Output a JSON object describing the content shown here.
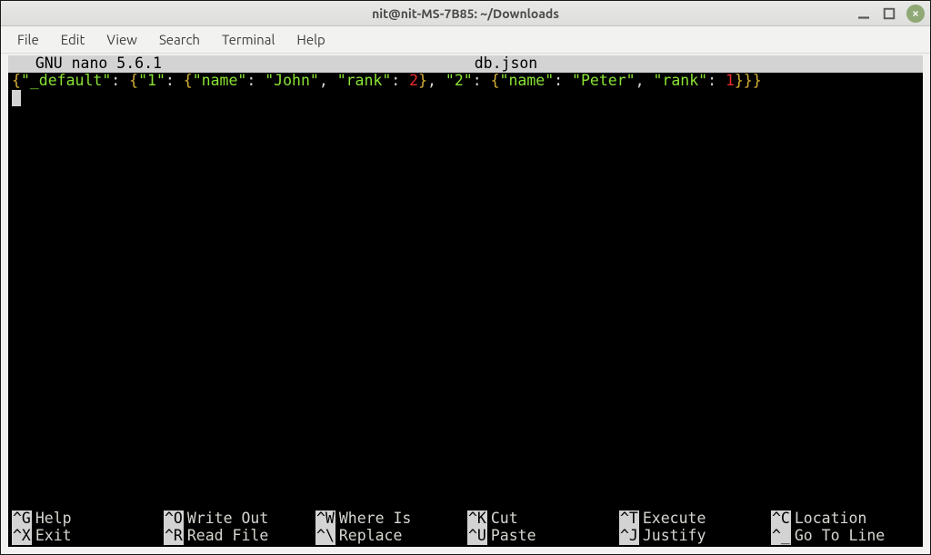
{
  "window": {
    "title": "nit@nit-MS-7B85: ~/Downloads"
  },
  "menubar": {
    "items": [
      "File",
      "Edit",
      "View",
      "Search",
      "Terminal",
      "Help"
    ]
  },
  "nano": {
    "header_app": "  GNU nano 5.6.1",
    "header_file": "db.json",
    "content": {
      "tokens": [
        {
          "t": "{",
          "c": "yellow"
        },
        {
          "t": "\"_default\"",
          "c": "green"
        },
        {
          "t": ": ",
          "c": "white"
        },
        {
          "t": "{",
          "c": "yellow"
        },
        {
          "t": "\"1\"",
          "c": "green"
        },
        {
          "t": ": ",
          "c": "white"
        },
        {
          "t": "{",
          "c": "yellow"
        },
        {
          "t": "\"name\"",
          "c": "green"
        },
        {
          "t": ": ",
          "c": "white"
        },
        {
          "t": "\"John\"",
          "c": "green"
        },
        {
          "t": ", ",
          "c": "white"
        },
        {
          "t": "\"rank\"",
          "c": "green"
        },
        {
          "t": ": ",
          "c": "white"
        },
        {
          "t": "2",
          "c": "red"
        },
        {
          "t": "}",
          "c": "yellow"
        },
        {
          "t": ", ",
          "c": "white"
        },
        {
          "t": "\"2\"",
          "c": "green"
        },
        {
          "t": ": ",
          "c": "white"
        },
        {
          "t": "{",
          "c": "yellow"
        },
        {
          "t": "\"name\"",
          "c": "green"
        },
        {
          "t": ": ",
          "c": "white"
        },
        {
          "t": "\"Peter\"",
          "c": "green"
        },
        {
          "t": ", ",
          "c": "white"
        },
        {
          "t": "\"rank\"",
          "c": "green"
        },
        {
          "t": ": ",
          "c": "white"
        },
        {
          "t": "1",
          "c": "red"
        },
        {
          "t": "}}}",
          "c": "yellow"
        }
      ]
    },
    "shortcuts_row1": [
      {
        "key": "^G",
        "label": "Help"
      },
      {
        "key": "^O",
        "label": "Write Out"
      },
      {
        "key": "^W",
        "label": "Where Is"
      },
      {
        "key": "^K",
        "label": "Cut"
      },
      {
        "key": "^T",
        "label": "Execute"
      },
      {
        "key": "^C",
        "label": "Location"
      }
    ],
    "shortcuts_row2": [
      {
        "key": "^X",
        "label": "Exit"
      },
      {
        "key": "^R",
        "label": "Read File"
      },
      {
        "key": "^\\",
        "label": "Replace"
      },
      {
        "key": "^U",
        "label": "Paste"
      },
      {
        "key": "^J",
        "label": "Justify"
      },
      {
        "key": "^_",
        "label": "Go To Line"
      }
    ]
  }
}
